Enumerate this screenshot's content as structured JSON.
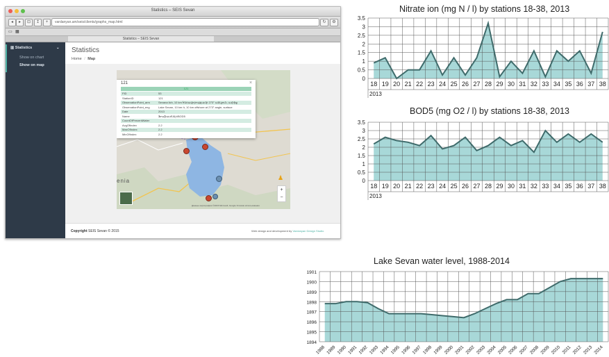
{
  "window": {
    "title": "Statistics – SEIS Sevan",
    "url": "vardanyan.am/seis/clients/graphs_map.html",
    "tab_title": "Statistics – SEIS Sevan"
  },
  "sidebar": {
    "section_label": "Statistics",
    "items": [
      {
        "label": "Show on chart"
      },
      {
        "label": "Show on map"
      }
    ]
  },
  "page": {
    "title": "Statistics",
    "breadcrumb": {
      "home": "Home",
      "sep": "/",
      "current": "Map"
    }
  },
  "map": {
    "country_label": "enia",
    "attribution": "Данные картографии ©2015 Microsoft, Google   Условия использования",
    "zoom_in": "+",
    "zoom_out": "−",
    "popup": {
      "title": "121",
      "close": "×",
      "header_value": "121",
      "rows": [
        {
          "key": "FID",
          "value": "53"
        },
        {
          "key": "StationID",
          "value": "121"
        },
        {
          "key": "ObservationPoint_arm",
          "value": "Sevana lich, 10 km հեռավորությամբ 273° անկյուն, ափից"
        },
        {
          "key": "ObservationPoint_eng",
          "value": "Lake Sevan, 10 km ռ, 10 km offshore at 273° angle, surface"
        },
        {
          "key": "Date",
          "value": "2013"
        },
        {
          "key": "Name",
          "value": "Ֆոսֆատներ/BOD5"
        },
        {
          "key": "CountOfPercentWater",
          "value": ""
        },
        {
          "key": "AvgOfIndex",
          "value": "2.2"
        },
        {
          "key": "MaxOfIndex",
          "value": "2.2"
        },
        {
          "key": "MinOfIndex",
          "value": "2.2"
        }
      ]
    }
  },
  "footer": {
    "copyright_label": "Copyright",
    "copyright_text": "SEIS Sevan © 2015",
    "credit_text": "Web design and development by",
    "credit_link": "Vardanyan Design Studio"
  },
  "colors": {
    "sidebar_bg": "#2e3a48",
    "chart_fill": "#a8d8d8",
    "chart_line": "#3f6b6b",
    "popup_header": "#9bd3b7"
  },
  "chart_data": [
    {
      "type": "area",
      "title": "Nitrate ion (mg N / l) by stations 18-38, 2013",
      "x": [
        "18",
        "19",
        "20",
        "21",
        "22",
        "23",
        "24",
        "25",
        "26",
        "27",
        "28",
        "29",
        "30",
        "31",
        "32",
        "33",
        "34",
        "35",
        "36",
        "37",
        "38"
      ],
      "values": [
        0.9,
        1.2,
        0.0,
        0.5,
        0.5,
        1.6,
        0.2,
        1.2,
        0.2,
        1.2,
        3.2,
        0.1,
        1.0,
        0.3,
        1.6,
        0.1,
        1.6,
        1.0,
        1.6,
        0.3,
        2.7
      ],
      "ylim": [
        0,
        3.5
      ],
      "yticks": [
        "0",
        "0.5",
        "1",
        "1.5",
        "2",
        "2.5",
        "3",
        "3.5"
      ],
      "year_label": "2013",
      "grid": true
    },
    {
      "type": "area",
      "title": "BOD5 (mg O2 / l) by stations 18-38, 2013",
      "x": [
        "18",
        "19",
        "20",
        "21",
        "22",
        "23",
        "24",
        "25",
        "26",
        "27",
        "28",
        "29",
        "30",
        "31",
        "32",
        "33",
        "34",
        "35",
        "36",
        "37",
        "38"
      ],
      "values": [
        2.2,
        2.6,
        2.4,
        2.3,
        2.1,
        2.7,
        1.9,
        2.1,
        2.6,
        1.8,
        2.1,
        2.6,
        2.1,
        2.4,
        1.7,
        3.0,
        2.3,
        2.8,
        2.3,
        2.8,
        2.3
      ],
      "ylim": [
        0,
        3.5
      ],
      "yticks": [
        "0",
        "0.5",
        "1",
        "1.5",
        "2",
        "2.5",
        "3",
        "3.5"
      ],
      "year_label": "2013",
      "grid": true
    },
    {
      "type": "area",
      "title": "Lake Sevan water level, 1988-2014",
      "x": [
        "1988",
        "1989",
        "1990",
        "1991",
        "1992",
        "1993",
        "1994",
        "1995",
        "1996",
        "1997",
        "1998",
        "1999",
        "2000",
        "2001",
        "2002",
        "2003",
        "2004",
        "2005",
        "2006",
        "2007",
        "2008",
        "2009",
        "2010",
        "2011",
        "2012",
        "2013",
        "2014"
      ],
      "values": [
        1897.8,
        1897.8,
        1898.0,
        1898.0,
        1897.9,
        1897.3,
        1896.8,
        1896.8,
        1896.8,
        1896.8,
        1896.7,
        1896.6,
        1896.5,
        1896.4,
        1896.8,
        1897.3,
        1897.8,
        1898.2,
        1898.2,
        1898.8,
        1898.8,
        1899.4,
        1900.0,
        1900.3,
        1900.3,
        1900.3,
        1900.3
      ],
      "ylim": [
        1894,
        1901
      ],
      "yticks": [
        "1894",
        "1895",
        "1896",
        "1897",
        "1898",
        "1899",
        "1900",
        "1901"
      ],
      "grid": true
    }
  ]
}
